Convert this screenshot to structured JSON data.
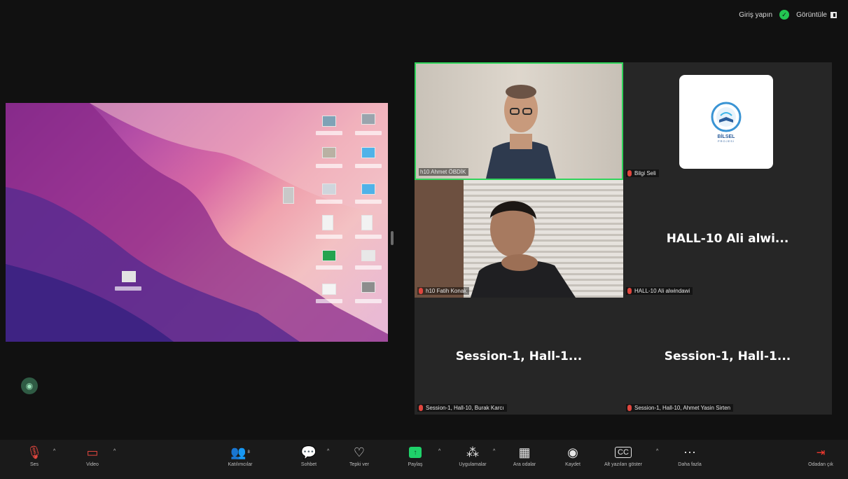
{
  "topbar": {
    "signin_label": "Giriş yapın",
    "view_label": "Görüntüle"
  },
  "participants": [
    {
      "name": "h10 Ahmet ÖBDİK",
      "muted": false,
      "video": true
    },
    {
      "name": "Bilgi Seli",
      "muted": true,
      "video": false,
      "logo_text": "BİLSEL",
      "logo_sub": "PROJESİ"
    },
    {
      "name": "h10 Fatih Konak",
      "muted": true,
      "video": true
    },
    {
      "name": "HALL-10 Ali alwindawi",
      "display": "HALL-10 Ali alwi...",
      "muted": true,
      "video": false
    },
    {
      "name": "Session-1, Hall-10, Burak Karcı",
      "display": "Session-1, Hall-1...",
      "muted": true,
      "video": false
    },
    {
      "name": "Session-1, Hall-10, Ahmet Yasin Sirten",
      "display": "Session-1, Hall-1...",
      "muted": true,
      "video": false
    }
  ],
  "toolbar": {
    "audio_label": "Ses",
    "video_label": "Video",
    "participants_label": "Katılımcılar",
    "participants_count": "8",
    "chat_label": "Sohbet",
    "react_label": "Tepki ver",
    "share_label": "Paylaş",
    "apps_label": "Uygulamalar",
    "rooms_label": "Ara odalar",
    "record_label": "Kaydet",
    "cc_label": "Alt yazıları göster",
    "more_label": "Daha fazla",
    "leave_label": "Odadan çık"
  },
  "colors": {
    "active_speaker": "#2fd35a",
    "muted": "#e0463e",
    "share_button": "#1fd26a",
    "leave": "#ff3b30"
  }
}
